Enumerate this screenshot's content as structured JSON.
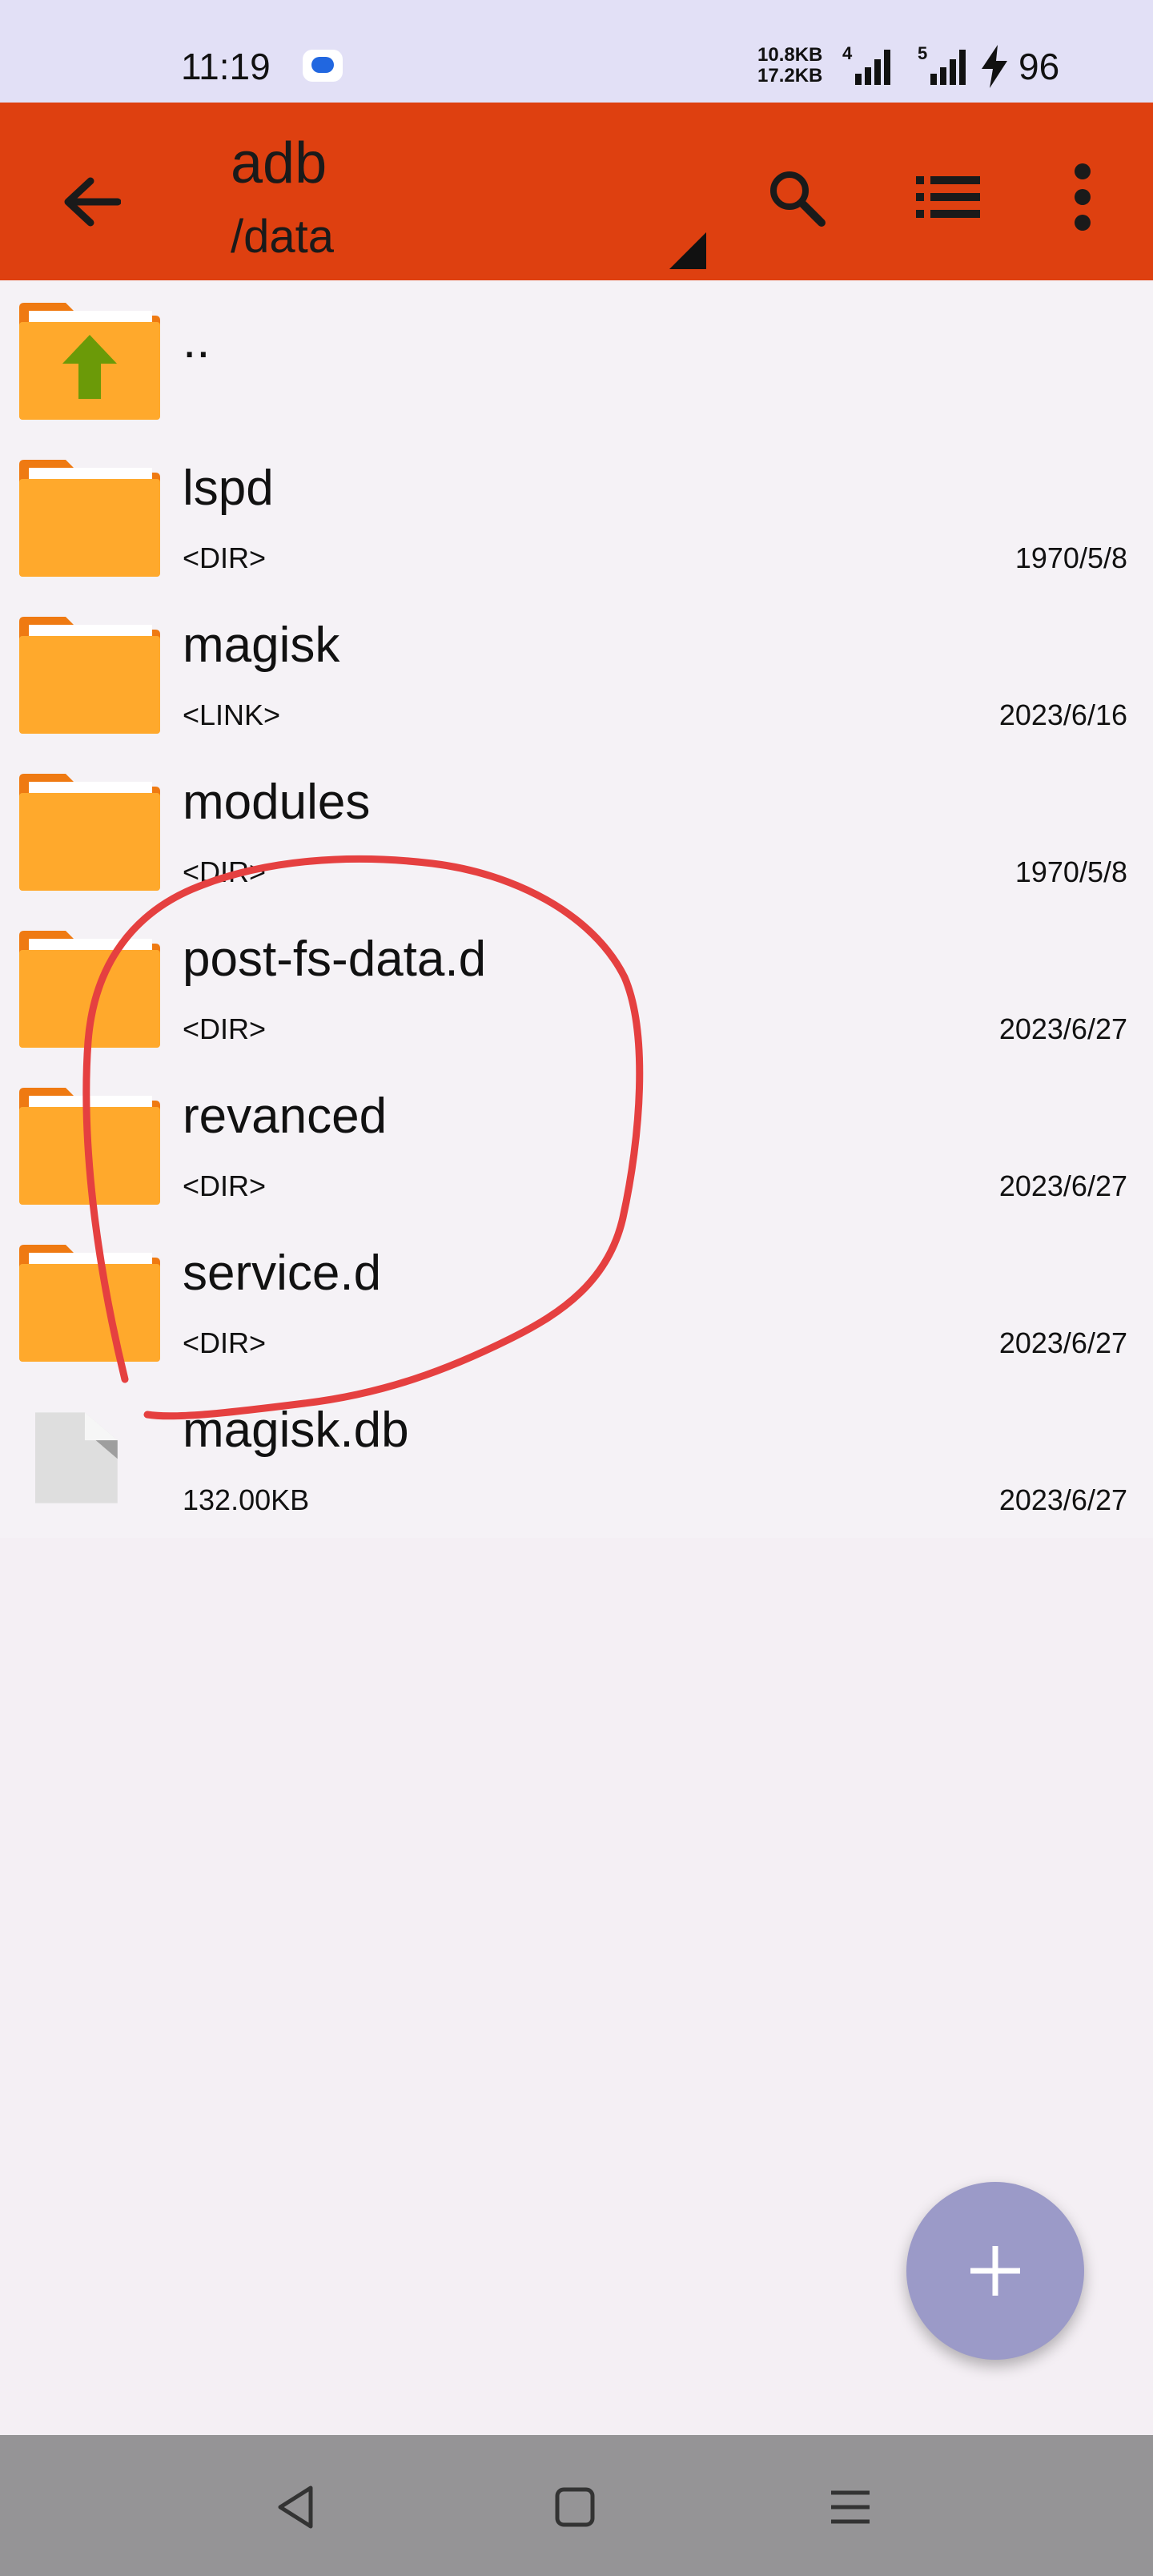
{
  "status_bar": {
    "time": "11:19",
    "net_up": "10.8KB",
    "net_down": "17.2KB",
    "sim1_label": "4",
    "sim2_label": "5",
    "battery": "96"
  },
  "toolbar": {
    "title": "adb",
    "path": "/data",
    "back_icon": "arrow-left-icon",
    "search_icon": "search-icon",
    "view_icon": "list-view-icon",
    "more_icon": "more-vert-icon",
    "color": "#de4010"
  },
  "files": [
    {
      "name": "..",
      "type": "",
      "date": "",
      "icon": "folder-up-icon"
    },
    {
      "name": "lspd",
      "type": "<DIR>",
      "date": "1970/5/8",
      "icon": "folder-icon"
    },
    {
      "name": "magisk",
      "type": "<LINK>",
      "date": "2023/6/16",
      "icon": "folder-icon"
    },
    {
      "name": "modules",
      "type": "<DIR>",
      "date": "1970/5/8",
      "icon": "folder-icon"
    },
    {
      "name": "post-fs-data.d",
      "type": "<DIR>",
      "date": "2023/6/27",
      "icon": "folder-icon"
    },
    {
      "name": "revanced",
      "type": "<DIR>",
      "date": "2023/6/27",
      "icon": "folder-icon"
    },
    {
      "name": "service.d",
      "type": "<DIR>",
      "date": "2023/6/27",
      "icon": "folder-icon"
    },
    {
      "name": "magisk.db",
      "type": "132.00KB",
      "date": "2023/6/27",
      "icon": "file-icon"
    }
  ],
  "fab": {
    "icon": "plus-icon",
    "color": "#9b9ac8"
  },
  "nav": {
    "back": "nav-back-icon",
    "home": "nav-home-icon",
    "recents": "nav-menu-icon"
  },
  "annotation": {
    "color": "#e54040"
  }
}
